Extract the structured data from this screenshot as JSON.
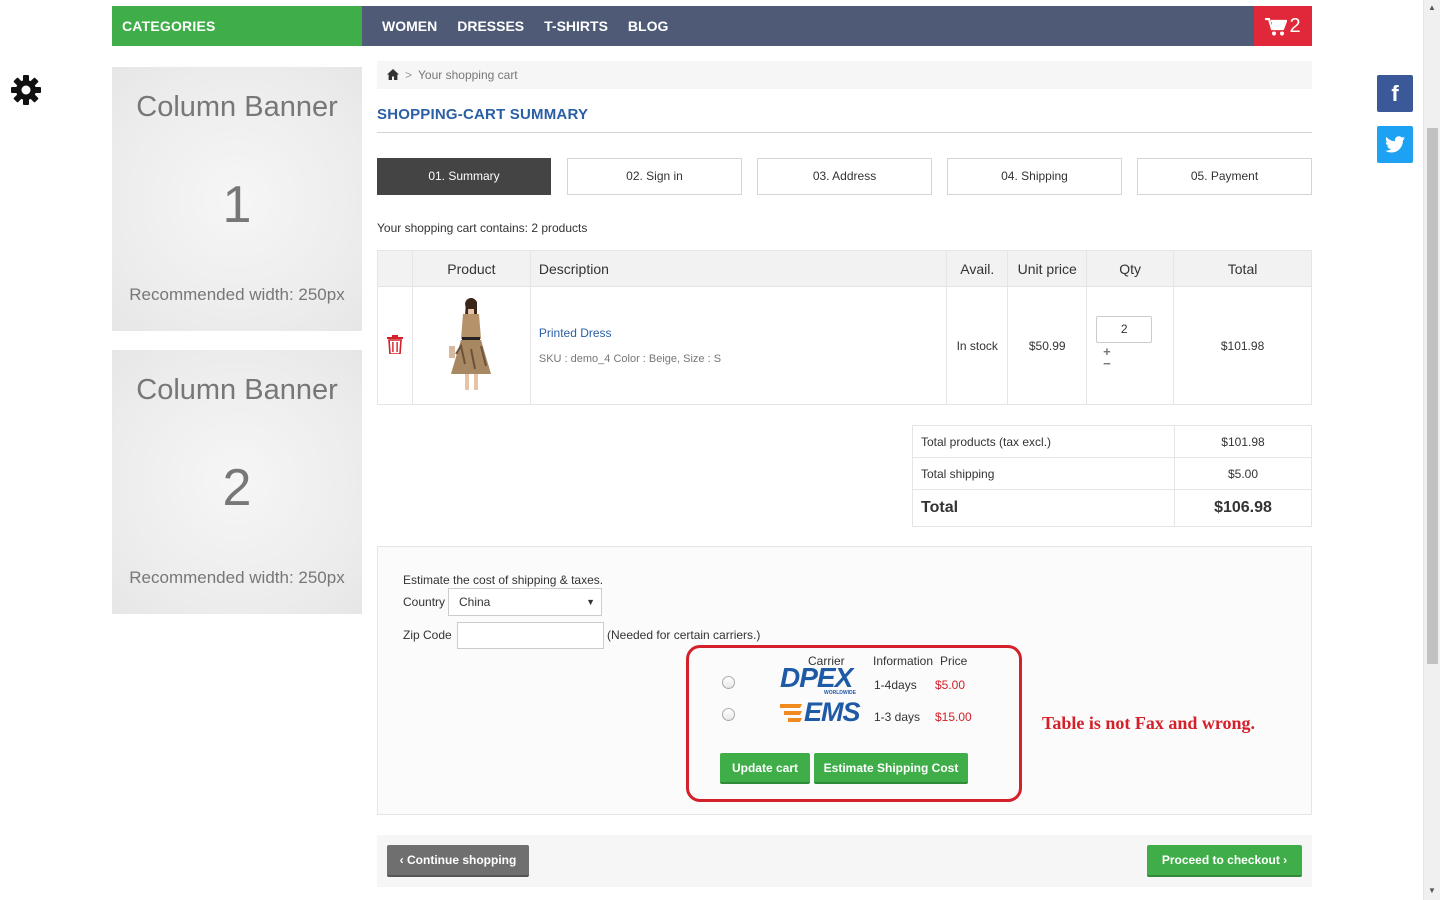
{
  "nav": {
    "categories": "CATEGORIES",
    "menu": [
      "WOMEN",
      "DRESSES",
      "T-SHIRTS",
      "BLOG"
    ],
    "cart_count": "2"
  },
  "banners": [
    {
      "title": "Column Banner",
      "number": "1",
      "recommend": "Recommended width: 250px"
    },
    {
      "title": "Column Banner",
      "number": "2",
      "recommend": "Recommended width: 250px"
    }
  ],
  "breadcrumb": {
    "current": "Your shopping cart",
    "separator": ">"
  },
  "page_title": "SHOPPING-CART SUMMARY",
  "steps": [
    "01. Summary",
    "02. Sign in",
    "03. Address",
    "04. Shipping",
    "05. Payment"
  ],
  "cart_summary_text": "Your shopping cart contains: 2 products",
  "table": {
    "headers": [
      "Product",
      "Description",
      "Avail.",
      "Unit price",
      "Qty",
      "Total"
    ],
    "row": {
      "name": "Printed Dress",
      "sku": "SKU : demo_4 Color : Beige, Size : S",
      "avail": "In stock",
      "unit_price": "$50.99",
      "qty": "2",
      "total": "$101.98"
    }
  },
  "totals": [
    {
      "label": "Total products (tax excl.)",
      "value": "$101.98"
    },
    {
      "label": "Total shipping",
      "value": "$5.00"
    },
    {
      "label": "Total",
      "value": "$106.98"
    }
  ],
  "estimate": {
    "intro": "Estimate the cost of shipping & taxes.",
    "country_label": "Country",
    "country_value": "China",
    "zip_label": "Zip Code",
    "zip_note": "(Needed for certain carriers.)",
    "col_carrier": "Carrier",
    "col_info": "Information",
    "col_price": "Price",
    "carriers": [
      {
        "logo": "DPEX",
        "logo_sub": "WORLDWIDE",
        "days": "1-4days",
        "price": "$5.00"
      },
      {
        "logo": "EMS",
        "days": "1-3 days",
        "price": "$15.00"
      }
    ],
    "update_button": "Update cart",
    "estimate_button": "Estimate Shipping Cost",
    "annotation": "Table is not Fax and wrong."
  },
  "bottom": {
    "continue": "Continue shopping",
    "checkout": "Proceed to checkout"
  },
  "social": {
    "facebook": "f",
    "twitter_icon": "twitter-icon"
  },
  "colors": {
    "green": "#3fae49",
    "nav": "#4f5b76",
    "red": "#e0283a",
    "link": "#2b5fa5"
  }
}
